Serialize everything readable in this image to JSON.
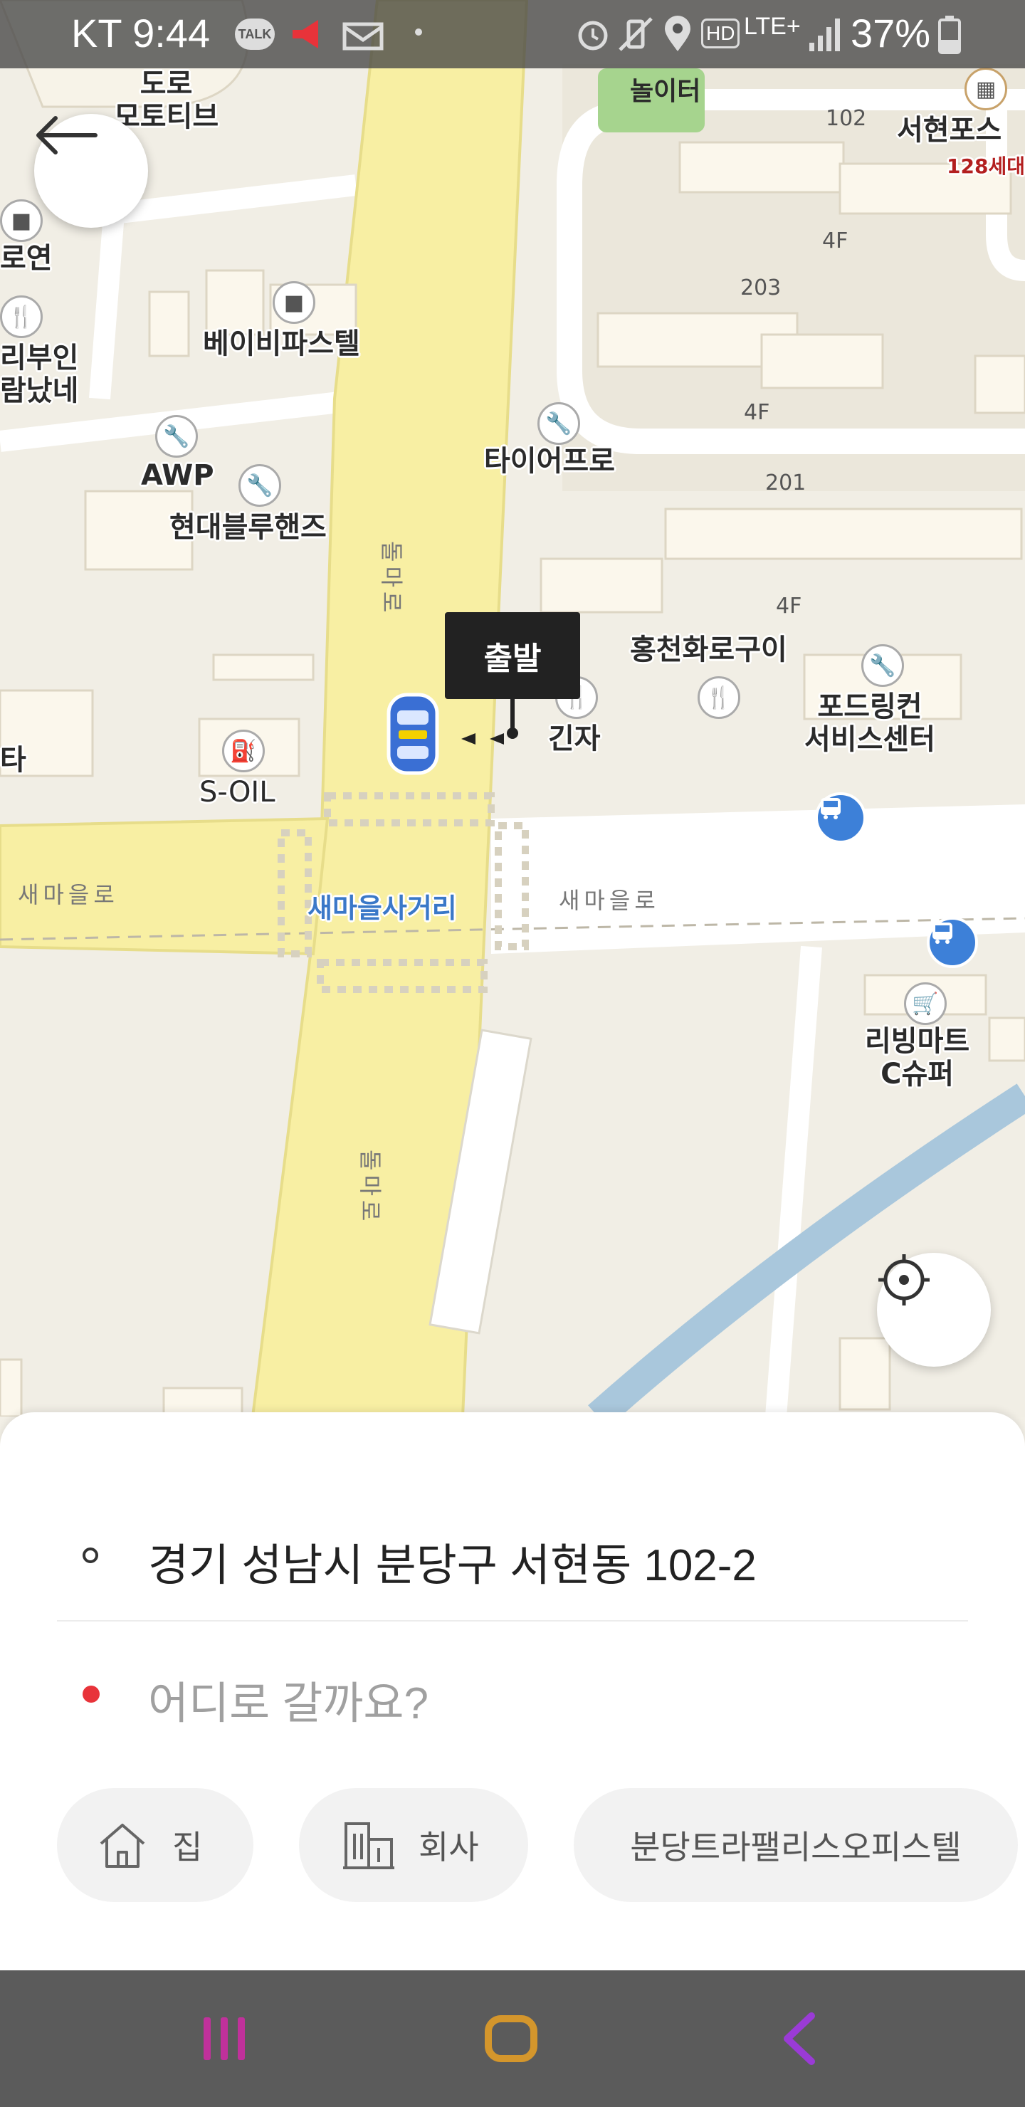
{
  "status_bar": {
    "carrier_time": "KT 9:44",
    "talk_badge": "TALK",
    "hd_label": "HD",
    "network": "LTE+",
    "battery": "37%"
  },
  "map": {
    "labels": {
      "road_mobility": "도로\n모토티브",
      "playground": "놀이터",
      "building_102": "102",
      "seohyun_top": "서현포스",
      "households": "128세대",
      "roen": "로연",
      "rebuin": "리부인\n람났네",
      "babypastel": "베이비파스텔",
      "awp": "AWP",
      "hyundai_bluehands": "현대블루핸즈",
      "tirepro": "타이어프로",
      "floor_4f_a": "4F",
      "building_203": "203",
      "floor_4f_b": "4F",
      "building_201": "201",
      "floor_4f_c": "4F",
      "hongcheon": "홍천화로구이",
      "ginja": "긴자",
      "fordlincoln": "포드링컨\n서비스센터",
      "ta": "타",
      "soil": "S-OIL",
      "saemaeul_road_left": "새마을로",
      "saemaeul_crossing": "새마을사거리",
      "saemaeul_road_right": "새마을로",
      "living_mart": "리빙마트\nC슈퍼",
      "dolmaero_top": "돌마로",
      "dolmaero_bottom": "돌마로"
    },
    "start_marker": "출발"
  },
  "sheet": {
    "origin": "경기 성남시 분당구 서현동 102-2",
    "destination_placeholder": "어디로 갈까요?",
    "chips": {
      "home": "집",
      "office": "회사",
      "favorite": "분당트라팰리스오피스텔"
    }
  },
  "colors": {
    "accent_red": "#e8333a",
    "bus_blue": "#3d80d8",
    "road_yellow": "#f8efa3"
  }
}
